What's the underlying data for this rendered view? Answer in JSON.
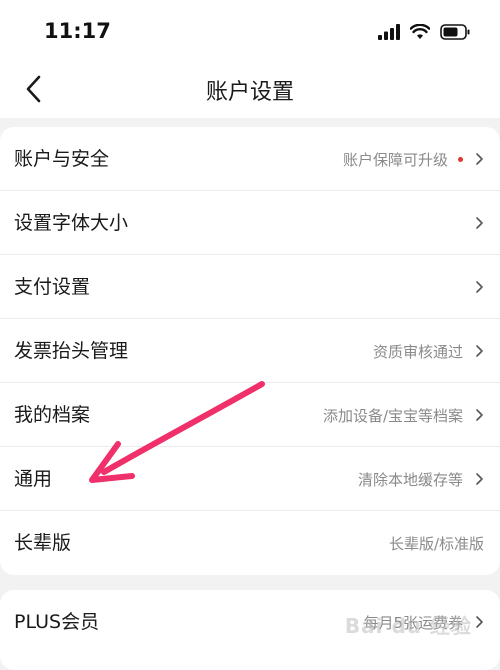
{
  "status": {
    "time": "11:17"
  },
  "nav": {
    "title": "账户设置"
  },
  "group1": [
    {
      "label": "账户与安全",
      "value": "账户保障可升级"
    },
    {
      "label": "设置字体大小",
      "value": ""
    },
    {
      "label": "支付设置",
      "value": ""
    },
    {
      "label": "发票抬头管理",
      "value": "资质审核通过"
    },
    {
      "label": "我的档案",
      "value": "添加设备/宝宝等档案"
    },
    {
      "label": "通用",
      "value": "清除本地缓存等"
    },
    {
      "label": "长辈版",
      "value": "长辈版/标准版"
    }
  ],
  "group2": [
    {
      "label": "PLUS会员",
      "value": "每月5张运费券"
    }
  ],
  "watermark": "Bai du 经验",
  "colors": {
    "accent_dot": "#e0382c",
    "annotation_arrow": "#f0306a"
  }
}
